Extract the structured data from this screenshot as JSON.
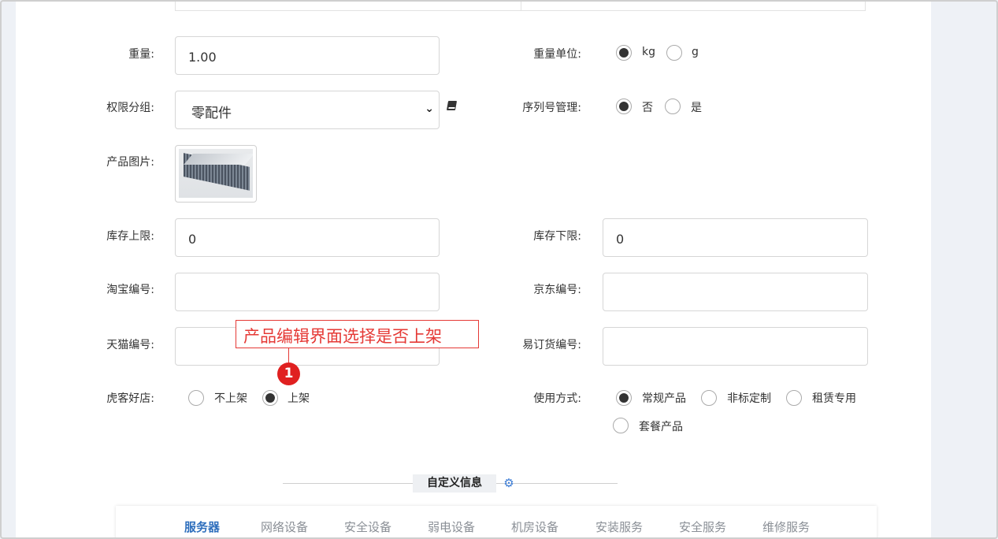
{
  "fields": {
    "weight_label": "重量:",
    "weight_value": "1.00",
    "weight_unit_label": "重量单位:",
    "weight_unit_options": [
      "kg",
      "g"
    ],
    "weight_unit_selected": "kg",
    "permission_group_label": "权限分组:",
    "permission_group_value": "零配件",
    "serial_mgmt_label": "序列号管理:",
    "serial_mgmt_options": [
      "否",
      "是"
    ],
    "serial_mgmt_selected": "否",
    "product_image_label": "产品图片:",
    "stock_upper_label": "库存上限:",
    "stock_upper_value": "0",
    "stock_lower_label": "库存下限:",
    "stock_lower_value": "0",
    "taobao_label": "淘宝编号:",
    "taobao_value": "",
    "jd_label": "京东编号:",
    "jd_value": "",
    "tmall_label": "天猫编号:",
    "tmall_value": "",
    "yidinghuo_label": "易订货编号:",
    "yidinghuo_value": "",
    "huke_label": "虎客好店:",
    "huke_options": [
      "不上架",
      "上架"
    ],
    "huke_selected": "上架",
    "usage_label": "使用方式:",
    "usage_options": [
      "常规产品",
      "非标定制",
      "租赁专用",
      "套餐产品"
    ],
    "usage_selected": "常规产品"
  },
  "annotation": {
    "text": "产品编辑界面选择是否上架",
    "badge": "1"
  },
  "custom_section": {
    "title": "自定义信息",
    "tabs": [
      "服务器",
      "网络设备",
      "安全设备",
      "弱电设备",
      "机房设备",
      "安装服务",
      "安全服务",
      "维修服务"
    ],
    "active_tab": "服务器"
  },
  "colors": {
    "annotation_red": "#e53935",
    "active_tab_blue": "#2f6fbd",
    "gear_blue": "#3a7bd5"
  },
  "icons": {
    "book": "book-icon",
    "gear": "gear-icon",
    "select_caret": "chevron-down-icon"
  }
}
